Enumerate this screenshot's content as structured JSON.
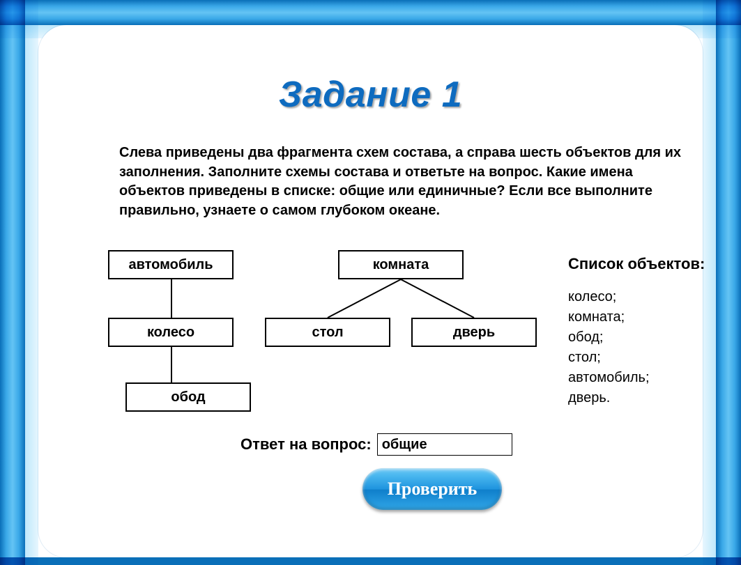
{
  "title": "Задание 1",
  "instructions": "Слева приведены два фрагмента схем состава, а справа шесть объектов для их заполнения. Заполните схемы состава и ответьте на вопрос. Какие имена объектов приведены в списке: общие или единичные? Если все выполните правильно, узнаете о самом глубоком океане.",
  "diagram": {
    "left_chain": {
      "top": "автомобиль",
      "mid": "колесо",
      "bottom": "обод"
    },
    "right_tree": {
      "root": "комната",
      "left": "стол",
      "right": "дверь"
    }
  },
  "object_list": {
    "header": "Список объектов:",
    "items": [
      "колесо;",
      "комната;",
      "обод;",
      "стол;",
      "автомобиль;",
      "дверь."
    ]
  },
  "answer": {
    "label": "Ответ на вопрос:",
    "value": "общие"
  },
  "check_button": "Проверить"
}
